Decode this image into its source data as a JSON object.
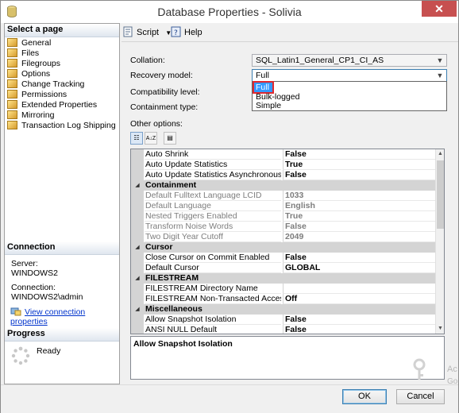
{
  "window": {
    "title": "Database Properties - Solivia",
    "close_glyph": "✕"
  },
  "left_pane": {
    "select_page_header": "Select a page",
    "pages": [
      "General",
      "Files",
      "Filegroups",
      "Options",
      "Change Tracking",
      "Permissions",
      "Extended Properties",
      "Mirroring",
      "Transaction Log Shipping"
    ],
    "connection_header": "Connection",
    "server_label": "Server:",
    "server_value": "WINDOWS2",
    "connection_label": "Connection:",
    "connection_value": "WINDOWS2\\admin",
    "view_connection_link": "View connection properties",
    "progress_header": "Progress",
    "progress_status": "Ready"
  },
  "toolbar": {
    "script_label": "Script",
    "help_label": "Help"
  },
  "form": {
    "collation_label": "Collation:",
    "collation_value": "SQL_Latin1_General_CP1_CI_AS",
    "recovery_model_label": "Recovery model:",
    "recovery_model_value": "Full",
    "recovery_model_options": [
      "Full",
      "Bulk-logged",
      "Simple"
    ],
    "compatibility_label": "Compatibility level:",
    "containment_label": "Containment type:",
    "other_options_label": "Other options:"
  },
  "grid_rows": [
    {
      "name": "Auto Shrink",
      "value": "False"
    },
    {
      "name": "Auto Update Statistics",
      "value": "True"
    },
    {
      "name": "Auto Update Statistics Asynchronously",
      "value": "False"
    },
    {
      "category": "Containment"
    },
    {
      "name": "Default Fulltext Language LCID",
      "value": "1033",
      "disabled": true
    },
    {
      "name": "Default Language",
      "value": "English",
      "disabled": true
    },
    {
      "name": "Nested Triggers Enabled",
      "value": "True",
      "disabled": true
    },
    {
      "name": "Transform Noise Words",
      "value": "False",
      "disabled": true
    },
    {
      "name": "Two Digit Year Cutoff",
      "value": "2049",
      "disabled": true
    },
    {
      "category": "Cursor"
    },
    {
      "name": "Close Cursor on Commit Enabled",
      "value": "False"
    },
    {
      "name": "Default Cursor",
      "value": "GLOBAL"
    },
    {
      "category": "FILESTREAM"
    },
    {
      "name": "FILESTREAM Directory Name",
      "value": ""
    },
    {
      "name": "FILESTREAM Non-Transacted Access",
      "value": "Off"
    },
    {
      "category": "Miscellaneous"
    },
    {
      "name": "Allow Snapshot Isolation",
      "value": "False"
    },
    {
      "name": "ANSI NULL Default",
      "value": "False"
    }
  ],
  "description": "Allow Snapshot Isolation",
  "buttons": {
    "ok": "OK",
    "cancel": "Cancel"
  },
  "watermark": "Ac\nGo",
  "colors": {
    "selection": "#3399ff",
    "highlight_box": "#e0282e",
    "close_button": "#c75050"
  }
}
